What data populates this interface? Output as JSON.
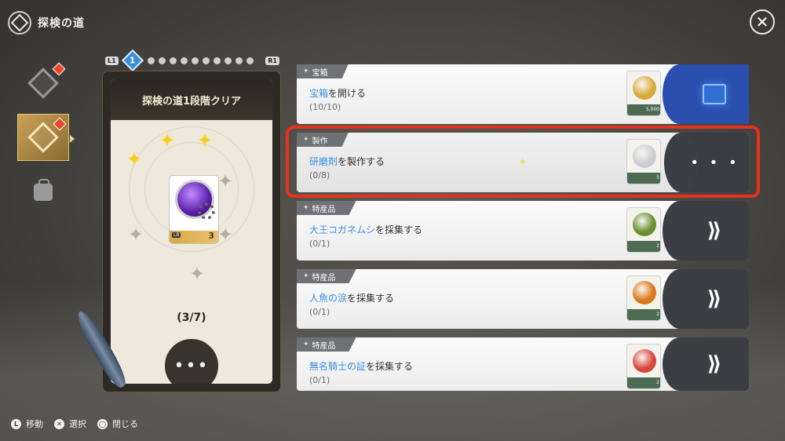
{
  "header": {
    "title": "探検の道",
    "close_icon": "close-icon"
  },
  "side_tabs": [
    {
      "icon": "compass-diamond-icon",
      "badge": true,
      "active": false
    },
    {
      "icon": "travel-path-icon",
      "badge": true,
      "active": true
    },
    {
      "icon": "bag-icon",
      "badge": false,
      "active": false
    }
  ],
  "pager": {
    "left_hint": "L1",
    "right_hint": "R1",
    "current": "1",
    "dots": 10
  },
  "stage_card": {
    "title": "探検の道1段階クリア",
    "stars_lit": 3,
    "stars_total": 7,
    "reward_count": "3",
    "reward_tag": "LB",
    "progress": "(3/7)",
    "more_label": "•••"
  },
  "tasks": [
    {
      "category": "宝箱",
      "title_highlight": "宝箱",
      "title_rest": "を開ける",
      "progress": "(10/10)",
      "item_count": "5,000",
      "item_color": "#d8a93b",
      "action": "gift-icon"
    },
    {
      "category": "製作",
      "title_highlight": "研磨剤",
      "title_rest": "を製作する",
      "progress": "(0/8)",
      "item_count": "5",
      "item_color": "#c9ccd1",
      "action": "more"
    },
    {
      "category": "特産品",
      "title_highlight": "大王コガネムシ",
      "title_rest": "を採集する",
      "progress": "(0/1)",
      "item_count": "2",
      "item_color": "#6a8f2e",
      "action": "go"
    },
    {
      "category": "特産品",
      "title_highlight": "人魚の涙",
      "title_rest": "を採集する",
      "progress": "(0/1)",
      "item_count": "2",
      "item_color": "#d8791a",
      "action": "go"
    },
    {
      "category": "特産品",
      "title_highlight": "無名騎士の証",
      "title_rest": "を採集する",
      "progress": "(0/1)",
      "item_count": "2",
      "item_color": "#d9443a",
      "action": "go"
    }
  ],
  "task_action_more": "• • •",
  "task_action_go": "⟫",
  "footer": {
    "hints": [
      {
        "button": "L",
        "label": "移動"
      },
      {
        "button": "✕",
        "label": "選択"
      },
      {
        "button": "◯",
        "label": "閉じる"
      }
    ]
  }
}
